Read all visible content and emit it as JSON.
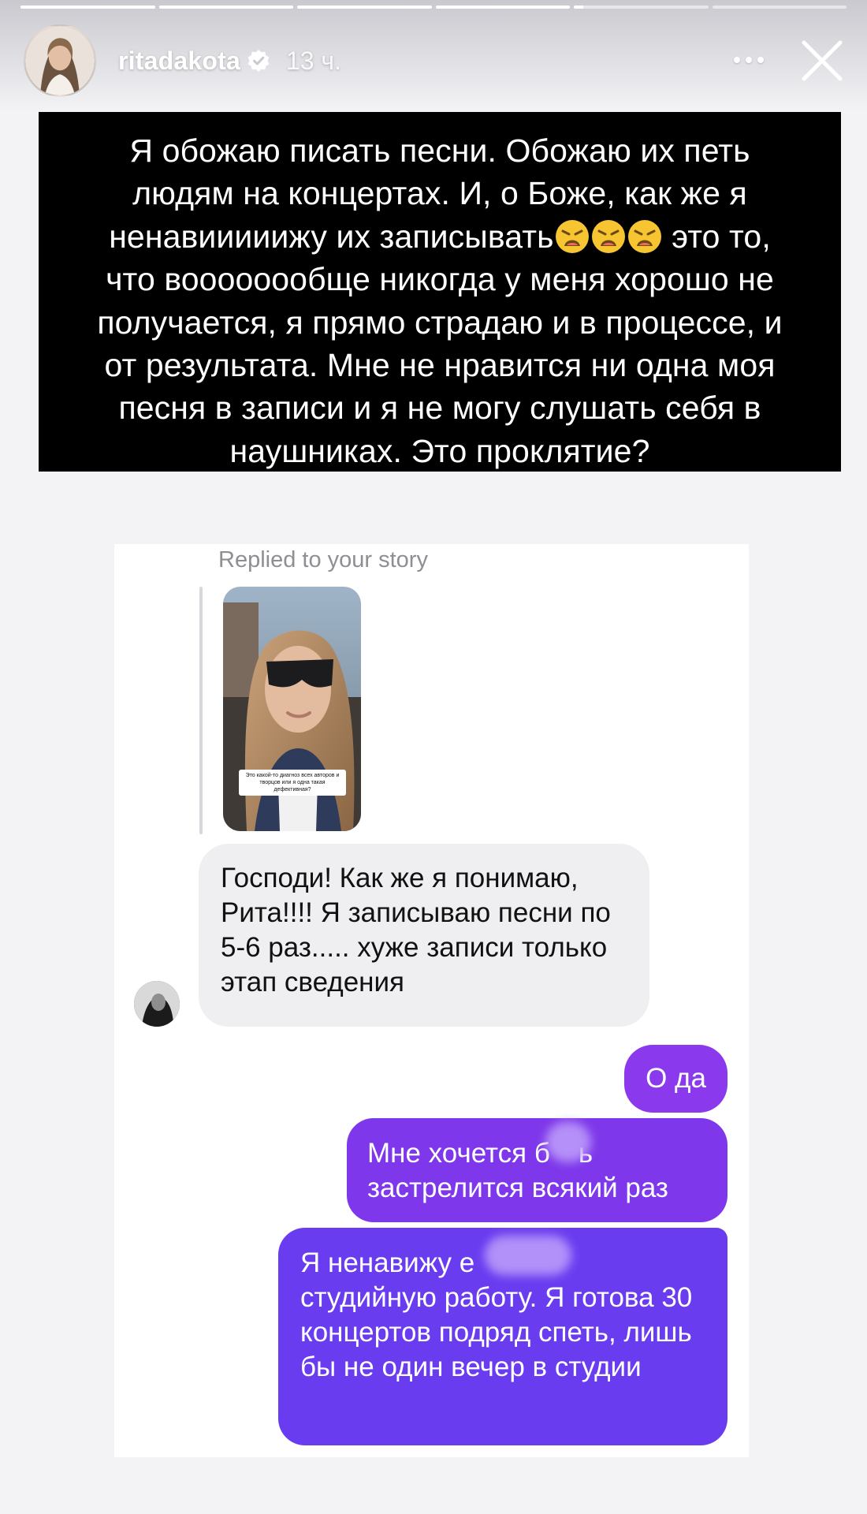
{
  "story": {
    "progress": [
      1,
      1,
      1,
      1,
      0.07,
      0
    ],
    "username": "ritadakota",
    "verified": true,
    "timestamp": "13 ч.",
    "more_icon": "more-dots-icon",
    "close_icon": "close-icon"
  },
  "caption": {
    "line1": "Я обожаю писать песни. Обожаю их петь",
    "line2": "людям на концертах. И, о Боже, как же я",
    "line3_before": "ненавииииижу их записывать",
    "line3_after": " это то,",
    "line4": "что воооооообще никогда у меня хорошо не",
    "line5": "получается, я прямо страдаю и в процессе, и",
    "line6": "от результата. Мне не нравится ни одна моя",
    "line7": "песня в записи и я не могу слушать себя в",
    "line8": "наушниках. Это проклятие?",
    "emoji_name": "weary-face-emoji"
  },
  "reply": {
    "header": "Replied to your story",
    "story_preview_text": "Это какой-то диагноз всех авторов и творцов или я одна такая дефективная?"
  },
  "messages": {
    "incoming": "Господи! Как же я понимаю, Рита!!!! Я записываю песни по 5-6 раз..... хуже записи только этап сведения",
    "out1": "О да",
    "out2_line1": "Мне хочется б",
    "out2_line1_end": "ь",
    "out2_line2": "застрелится всякий раз",
    "out3_line1": "Я ненавижу е",
    "out3_rest": "студийную работу. Я готова 30 концертов подряд спеть, лишь бы не один вечер в студии"
  }
}
